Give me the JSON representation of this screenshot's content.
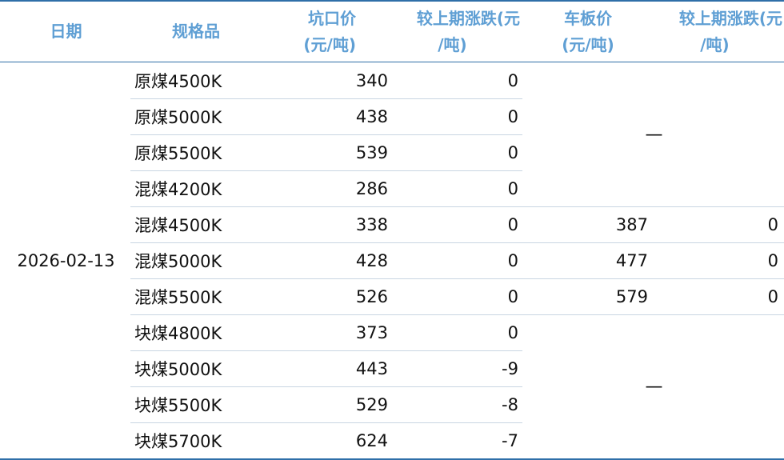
{
  "header": {
    "date": "日期",
    "spec": "规格品",
    "pit_price_l1": "坑口价",
    "pit_price_l2": "(元/吨)",
    "pit_change_l1": "较上期涨跌(元",
    "pit_change_l2": "/吨)",
    "board_price_l1": "车板价",
    "board_price_l2": "(元/吨)",
    "board_change_l1": "较上期涨跌(元",
    "board_change_l2": "/吨)"
  },
  "date_value": "2026-02-13",
  "rows": [
    {
      "spec": "原煤4500K",
      "pit_price": "340",
      "pit_change": "0"
    },
    {
      "spec": "原煤5000K",
      "pit_price": "438",
      "pit_change": "0"
    },
    {
      "spec": "原煤5500K",
      "pit_price": "539",
      "pit_change": "0"
    },
    {
      "spec": "混煤4200K",
      "pit_price": "286",
      "pit_change": "0"
    },
    {
      "spec": "混煤4500K",
      "pit_price": "338",
      "pit_change": "0",
      "board_price": "387",
      "board_change": "0"
    },
    {
      "spec": "混煤5000K",
      "pit_price": "428",
      "pit_change": "0",
      "board_price": "477",
      "board_change": "0"
    },
    {
      "spec": "混煤5500K",
      "pit_price": "526",
      "pit_change": "0",
      "board_price": "579",
      "board_change": "0"
    },
    {
      "spec": "块煤4800K",
      "pit_price": "373",
      "pit_change": "0"
    },
    {
      "spec": "块煤5000K",
      "pit_price": "443",
      "pit_change": "-9"
    },
    {
      "spec": "块煤5500K",
      "pit_price": "529",
      "pit_change": "-8"
    },
    {
      "spec": "块煤5700K",
      "pit_price": "624",
      "pit_change": "-7"
    }
  ],
  "empty_marker": "—"
}
